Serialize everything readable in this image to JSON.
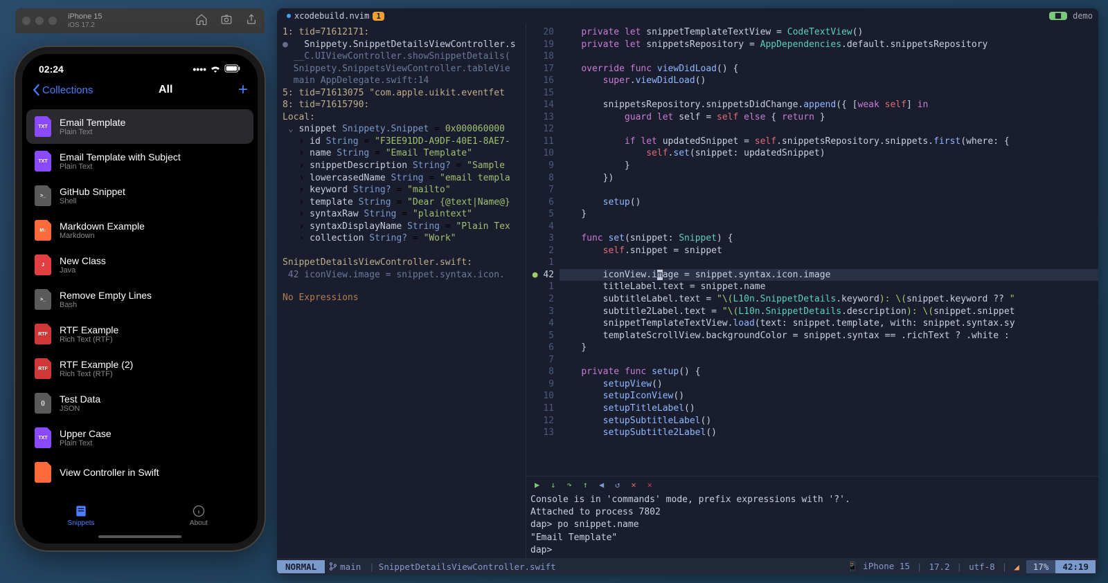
{
  "simulator": {
    "device_name": "iPhone 15",
    "os_version": "iOS 17.2",
    "clock": "02:24",
    "nav_back": "Collections",
    "nav_title": "All",
    "snippets": [
      {
        "title": "Email Template",
        "subtitle": "Plain Text",
        "icon": "purple",
        "badge": "TXT"
      },
      {
        "title": "Email Template with Subject",
        "subtitle": "Plain Text",
        "icon": "purple",
        "badge": "TXT"
      },
      {
        "title": "GitHub Snippet",
        "subtitle": "Shell",
        "icon": "gray",
        "badge": ">_"
      },
      {
        "title": "Markdown Example",
        "subtitle": "Markdown",
        "icon": "orange",
        "badge": "M↓"
      },
      {
        "title": "New Class",
        "subtitle": "Java",
        "icon": "red",
        "badge": "J"
      },
      {
        "title": "Remove Empty Lines",
        "subtitle": "Bash",
        "icon": "gray",
        "badge": ">_"
      },
      {
        "title": "RTF Example",
        "subtitle": "Rich Text (RTF)",
        "icon": "red2",
        "badge": "RTF"
      },
      {
        "title": "RTF Example (2)",
        "subtitle": "Rich Text (RTF)",
        "icon": "red2",
        "badge": "RTF"
      },
      {
        "title": "Test Data",
        "subtitle": "JSON",
        "icon": "gray",
        "badge": "{}"
      },
      {
        "title": "Upper Case",
        "subtitle": "Plain Text",
        "icon": "purple",
        "badge": "TXT"
      },
      {
        "title": "View Controller in Swift",
        "subtitle": "",
        "icon": "orange",
        "badge": ""
      }
    ],
    "tab1": "Snippets",
    "tab2": "About"
  },
  "tabline": {
    "file": "xcodebuild.nvim",
    "badge": "1",
    "right_label": "demo"
  },
  "left_pane": {
    "l1": "1: tid=71612171:",
    "l2": "  Snippety.SnippetDetailsViewController.s",
    "l3": "  __C.UIViewController.showSnippetDetails(",
    "l4": "  Snippety.SnippetsViewController.tableVie",
    "l5": "  main AppDelegate.swift:14",
    "l6": "",
    "l7": "5: tid=71613075 \"com.apple.uikit.eventfet",
    "l8": "",
    "l9": "8: tid=71615790:",
    "l10": "",
    "local": "Local:",
    "v1": "snippet Snippety.Snippet = 0x000060000",
    "v2": "id String = \"F3EE91DD-A9DF-40E1-8AE7-",
    "v3": "name String = \"Email Template\"",
    "v4": "snippetDescription String? = \"Sample",
    "v5": "lowercasedName String = \"email templa",
    "v6": "keyword String? = \"mailto\"",
    "v7": "template String = \"Dear {@text|Name@}",
    "v8": "syntaxRaw String = \"plaintext\"",
    "v9": "syntaxDisplayName String = \"Plain Tex",
    "v10": "collection String? = \"Work\"",
    "file_loc": "SnippetDetailsViewController.swift:",
    "file_line": " 42 iconView.image = snippet.syntax.icon.",
    "no_expr": "No Expressions"
  },
  "right_pane_gutter": [
    "20",
    "19",
    "18",
    "17",
    "16",
    "15",
    "14",
    "13",
    "12",
    "11",
    "10",
    "9",
    "8",
    "7",
    "6",
    "5",
    "4",
    "3",
    "2",
    "1",
    "42",
    "1",
    "2",
    "3",
    "4",
    "5",
    "6",
    "7",
    "8",
    "9",
    "10",
    "11",
    "12",
    "13"
  ],
  "debug_toolbar": [
    "▶",
    "↓",
    "↷",
    "↑",
    "◀",
    "↺",
    "✕",
    "✕"
  ],
  "debug_console": {
    "l1": "Console is in 'commands' mode, prefix expressions with '?'.",
    "l2": "Attached to process 7802",
    "l3": "dap> po snippet.name",
    "l4": "\"Email Template\"",
    "l5": "",
    "l6": "dap>"
  },
  "statusline": {
    "mode": "NORMAL",
    "branch": "main",
    "file": "SnippetDetailsViewController.swift",
    "device": "iPhone 15",
    "os": "17.2",
    "enc": "utf-8",
    "pct": "17%",
    "pos": "42:19"
  }
}
